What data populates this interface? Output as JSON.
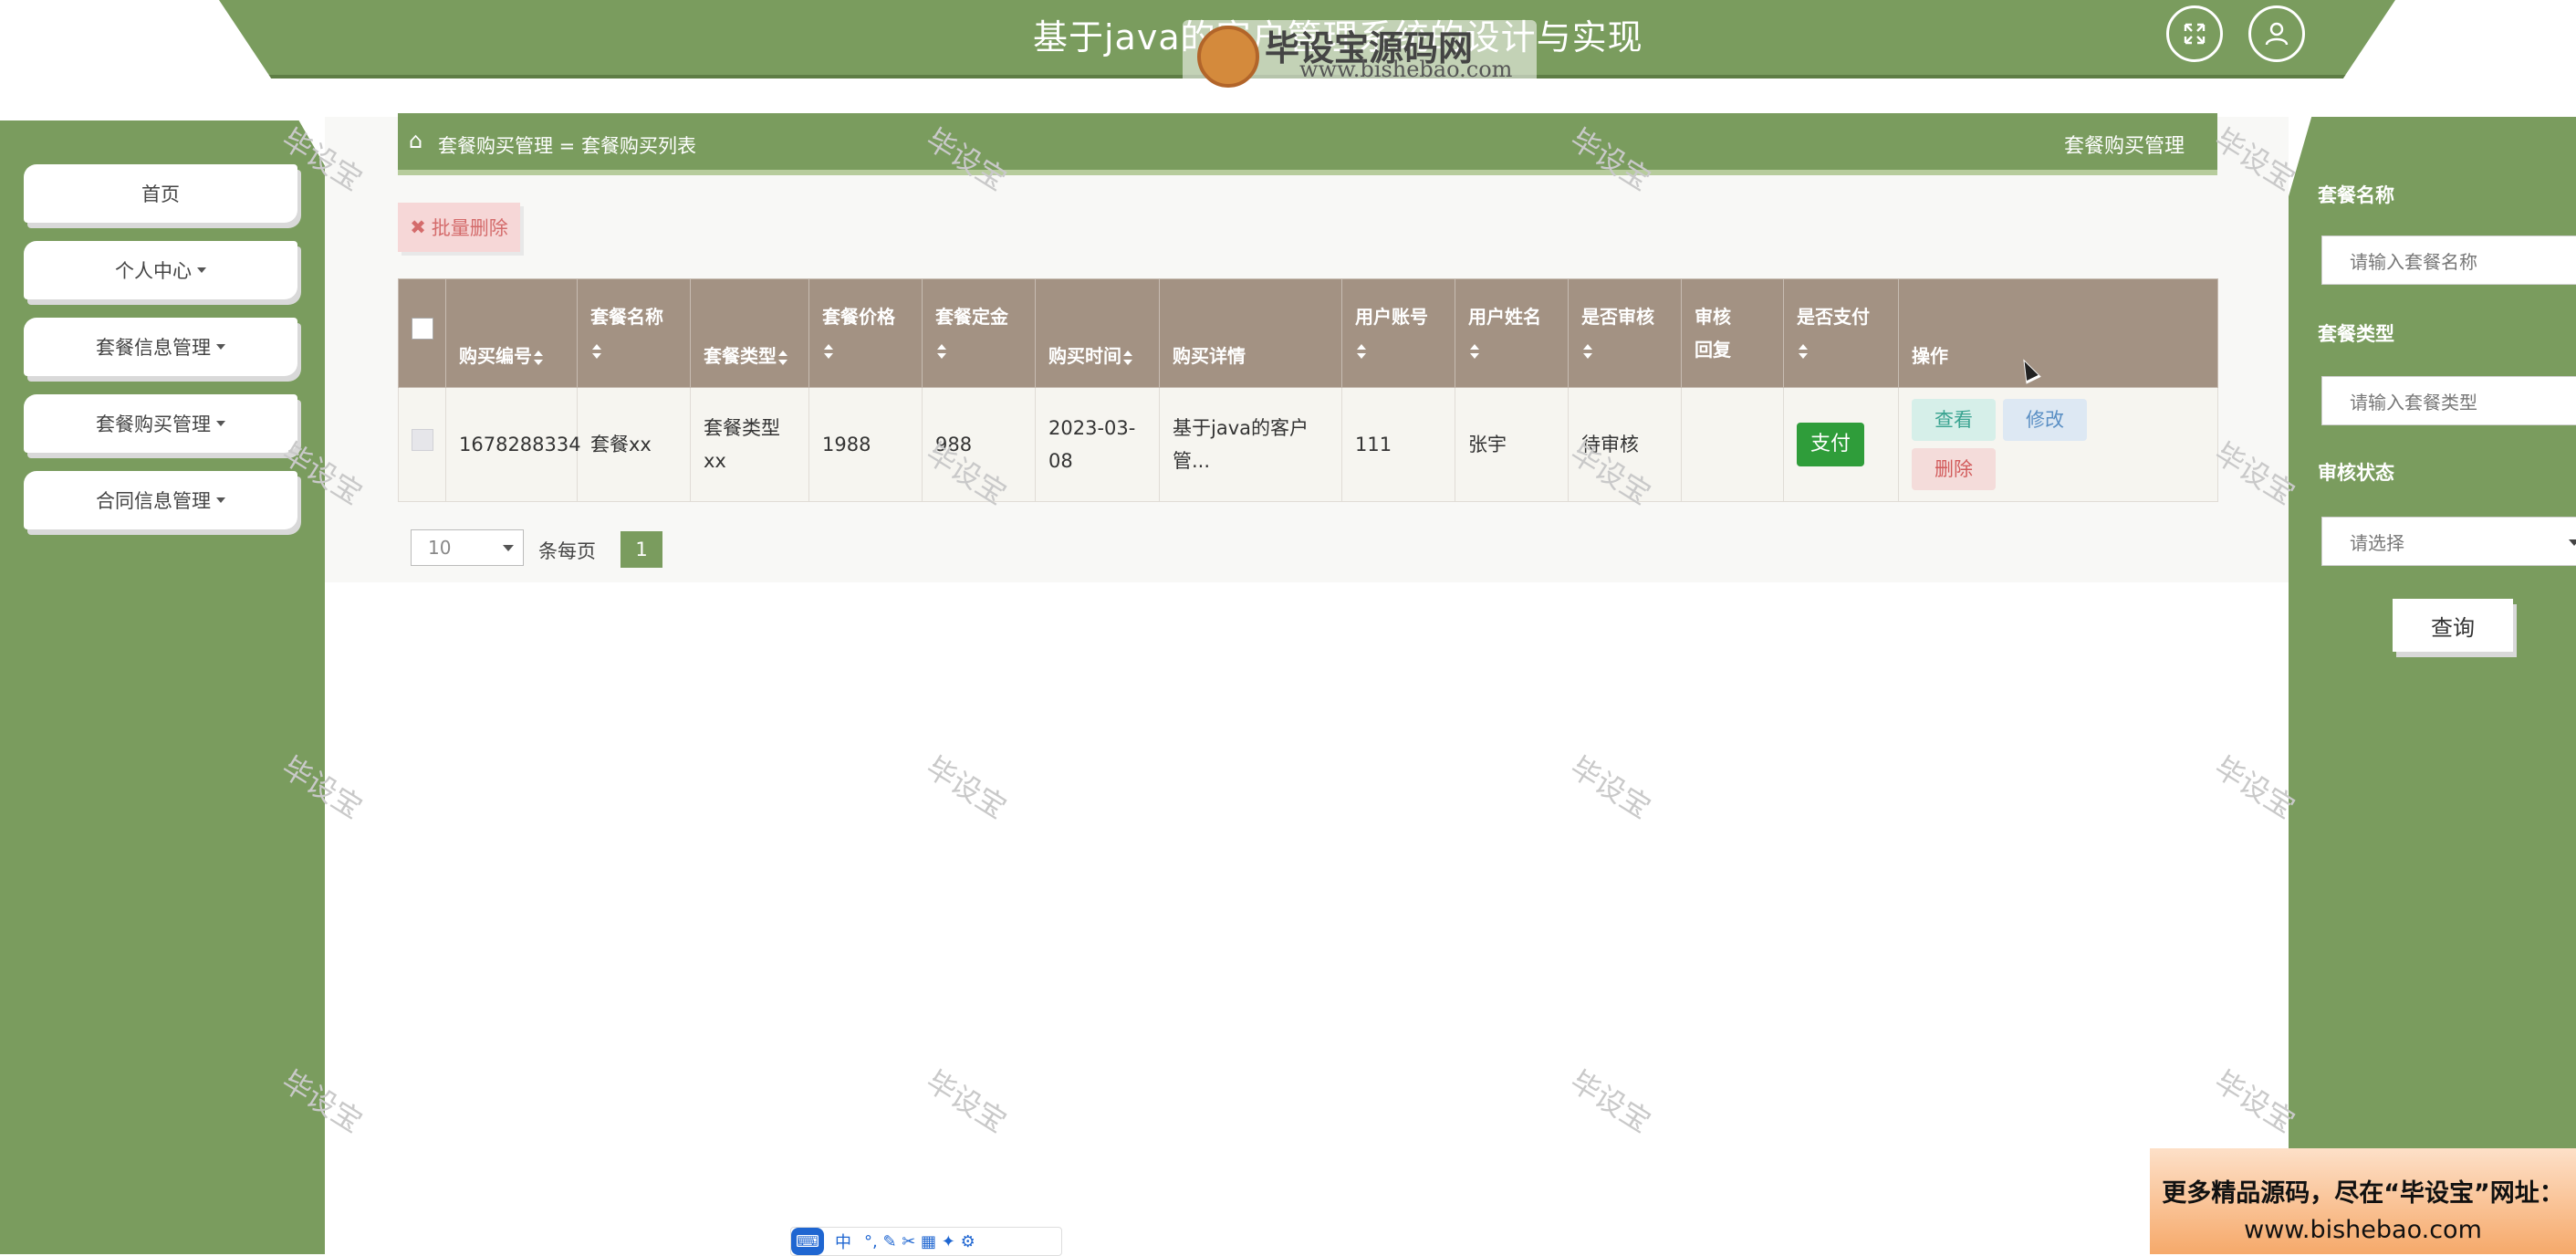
{
  "header": {
    "title": "基于java的客户管理系统的设计与实现",
    "logo_name": "毕设宝源码网",
    "logo_url": "www.bishebao.com",
    "fullscreen_icon": "expand-icon",
    "user_icon": "user-icon"
  },
  "watermark": "毕设宝",
  "sidebar": {
    "items": [
      {
        "label": "首页"
      },
      {
        "label": "个人中心"
      },
      {
        "label": "套餐信息管理"
      },
      {
        "label": "套餐购买管理"
      },
      {
        "label": "合同信息管理"
      }
    ]
  },
  "breadcrumb": {
    "home_icon": "home-icon",
    "path": "套餐购买管理 = 套餐购买列表",
    "right_title": "套餐购买管理"
  },
  "toolbar": {
    "batch_delete": "批量删除"
  },
  "table": {
    "columns": [
      "购买编号",
      "套餐名称",
      "套餐类型",
      "套餐价格",
      "套餐定金",
      "购买时间",
      "购买详情",
      "用户账号",
      "用户姓名",
      "是否审核",
      "审核回复",
      "是否支付",
      "操作"
    ],
    "rows": [
      {
        "id": "1678288334",
        "name": "套餐xx",
        "type": "套餐类型xx",
        "price": "1988",
        "deposit": "988",
        "time": "2023-03-08",
        "detail": "基于java的客户管...",
        "account": "111",
        "username": "张宇",
        "audit": "待审核",
        "reply": "",
        "pay_button": "支付",
        "actions": {
          "view": "查看",
          "edit": "修改",
          "delete": "删除"
        }
      }
    ]
  },
  "pagination": {
    "page_size": "10",
    "per_page_label": "条每页",
    "current_page": "1"
  },
  "search": {
    "name_label": "套餐名称",
    "name_placeholder": "请输入套餐名称",
    "type_label": "套餐类型",
    "type_placeholder": "请输入套餐类型",
    "status_label": "审核状态",
    "status_value": "请选择",
    "query_button": "查询"
  },
  "promo": {
    "line1": "更多精品源码，尽在“毕设宝”网址：",
    "line2": "www.bishebao.com"
  },
  "ime": {
    "label1": "中",
    "tools": "°, ✎ ✂ ▦ ✦ ⚙"
  },
  "colors": {
    "primary": "#7a9c5e",
    "table_header": "#a39283",
    "pay": "#2f9d3a"
  }
}
